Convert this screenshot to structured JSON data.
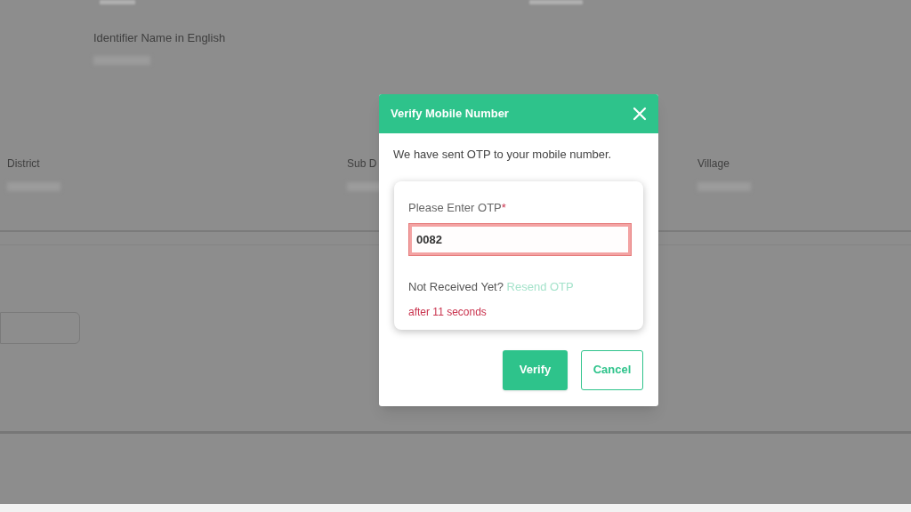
{
  "background_form": {
    "identifier_label": "Identifier Name in English",
    "location_labels": [
      "District",
      "Sub D",
      "Village"
    ]
  },
  "dialog": {
    "title": "Verify Mobile Number",
    "message": "We have sent OTP to your mobile number.",
    "otp_field": {
      "label": "Please Enter OTP",
      "required_mark": "*",
      "value": "0082",
      "invalid": true
    },
    "resend_prompt": "Not Received Yet?",
    "resend_link": "Resend OTP",
    "resend_disabled": true,
    "countdown": "after 11 seconds",
    "buttons": [
      {
        "label": "Verify",
        "kind": "primary"
      },
      {
        "label": "Cancel",
        "kind": "secondary"
      }
    ]
  }
}
